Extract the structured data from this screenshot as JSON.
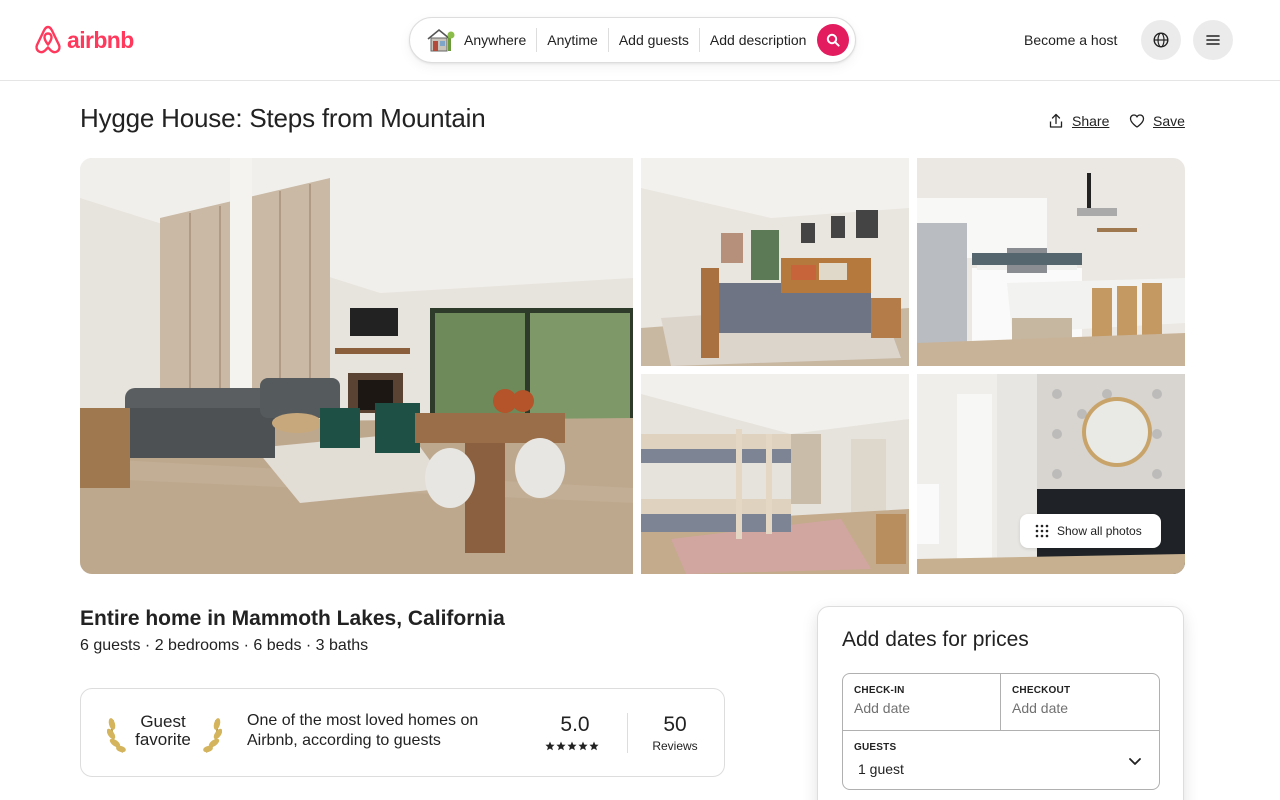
{
  "brand": {
    "name": "airbnb",
    "color": "#ff385c"
  },
  "search": {
    "where": "Anywhere",
    "when": "Anytime",
    "guests": "Add guests",
    "description": "Add description",
    "button_color": "#e31c5f"
  },
  "nav": {
    "become_host": "Become a host",
    "globe_icon": "globe-icon",
    "menu_icon": "hamburger-menu-icon"
  },
  "listing": {
    "title": "Hygge House: Steps from Mountain",
    "share_label": "Share",
    "save_label": "Save",
    "photos": [
      "living room",
      "bedroom",
      "kitchen",
      "bunk room",
      "bathroom"
    ],
    "show_all_photos": "Show all photos",
    "subtitle": "Entire home in Mammoth Lakes, California",
    "details": [
      "6 guests",
      "2 bedrooms",
      "6 beds",
      "3 baths"
    ],
    "details_line": "6 guests · 2 bedrooms · 6 beds · 3 baths"
  },
  "guest_favorite": {
    "label_line1": "Guest",
    "label_line2": "favorite",
    "description": "One of the most loved homes on Airbnb, according to guests",
    "rating": "5.0",
    "stars": 5,
    "reviews_count": "50",
    "reviews_label": "Reviews"
  },
  "booking": {
    "title": "Add dates for prices",
    "checkin_label": "CHECK-IN",
    "checkin_value": "Add date",
    "checkout_label": "CHECKOUT",
    "checkout_value": "Add date",
    "guests_label": "GUESTS",
    "guests_value": "1 guest"
  }
}
